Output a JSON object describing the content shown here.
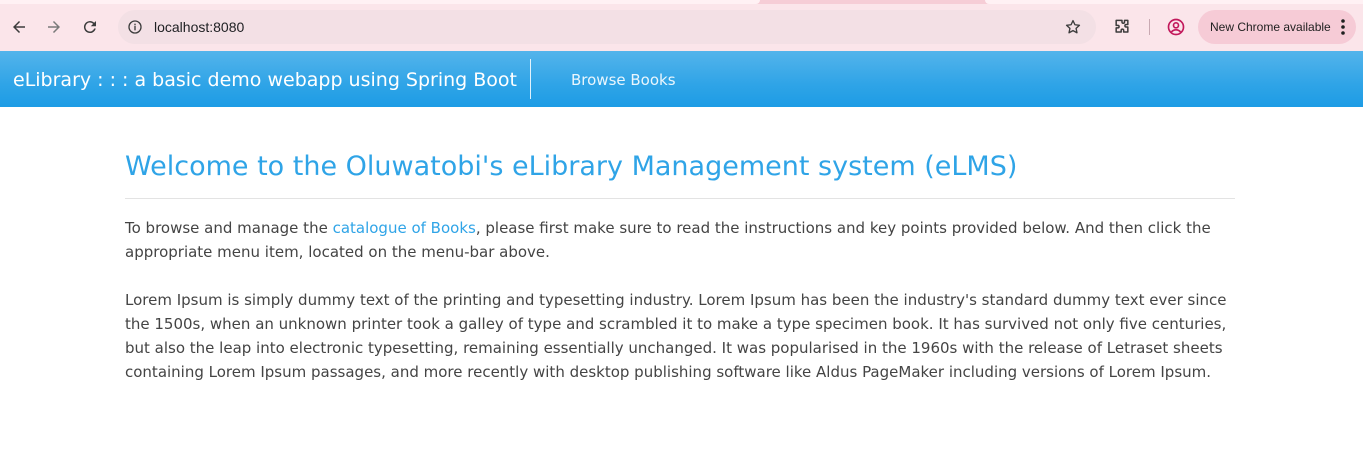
{
  "browser": {
    "url": "localhost:8080",
    "update_label": "New Chrome available",
    "icons": {
      "back": "arrow-left-icon",
      "forward": "arrow-right-icon",
      "reload": "reload-icon",
      "site_info": "info-icon",
      "bookmark": "star-icon",
      "extensions": "puzzle-icon",
      "profile": "profile-icon",
      "menu": "more-vert-icon"
    }
  },
  "navbar": {
    "brand": "eLibrary : : : a basic demo webapp using Spring Boot",
    "links": [
      {
        "label": "Browse Books"
      }
    ],
    "colors": {
      "background": "#2fa4e7",
      "text": "#ffffff"
    }
  },
  "main": {
    "title": "Welcome to the Oluwatobi's eLibrary Management system (eLMS)",
    "intro": {
      "before_link": "To browse and manage the ",
      "link_text": "catalogue of Books",
      "after_link": ", please first make sure to read the instructions and key points provided below. And then click the appropriate menu item, located on the menu-bar above."
    },
    "body": "Lorem Ipsum is simply dummy text of the printing and typesetting industry. Lorem Ipsum has been the industry's standard dummy text ever since the 1500s, when an unknown printer took a galley of type and scrambled it to make a type specimen book. It has survived not only five centuries, but also the leap into electronic typesetting, remaining essentially unchanged. It was popularised in the 1960s with the release of Letraset sheets containing Lorem Ipsum passages, and more recently with desktop publishing software like Aldus PageMaker including versions of Lorem Ipsum."
  },
  "colors": {
    "accent": "#2fa4e7",
    "body_text": "#444444"
  }
}
